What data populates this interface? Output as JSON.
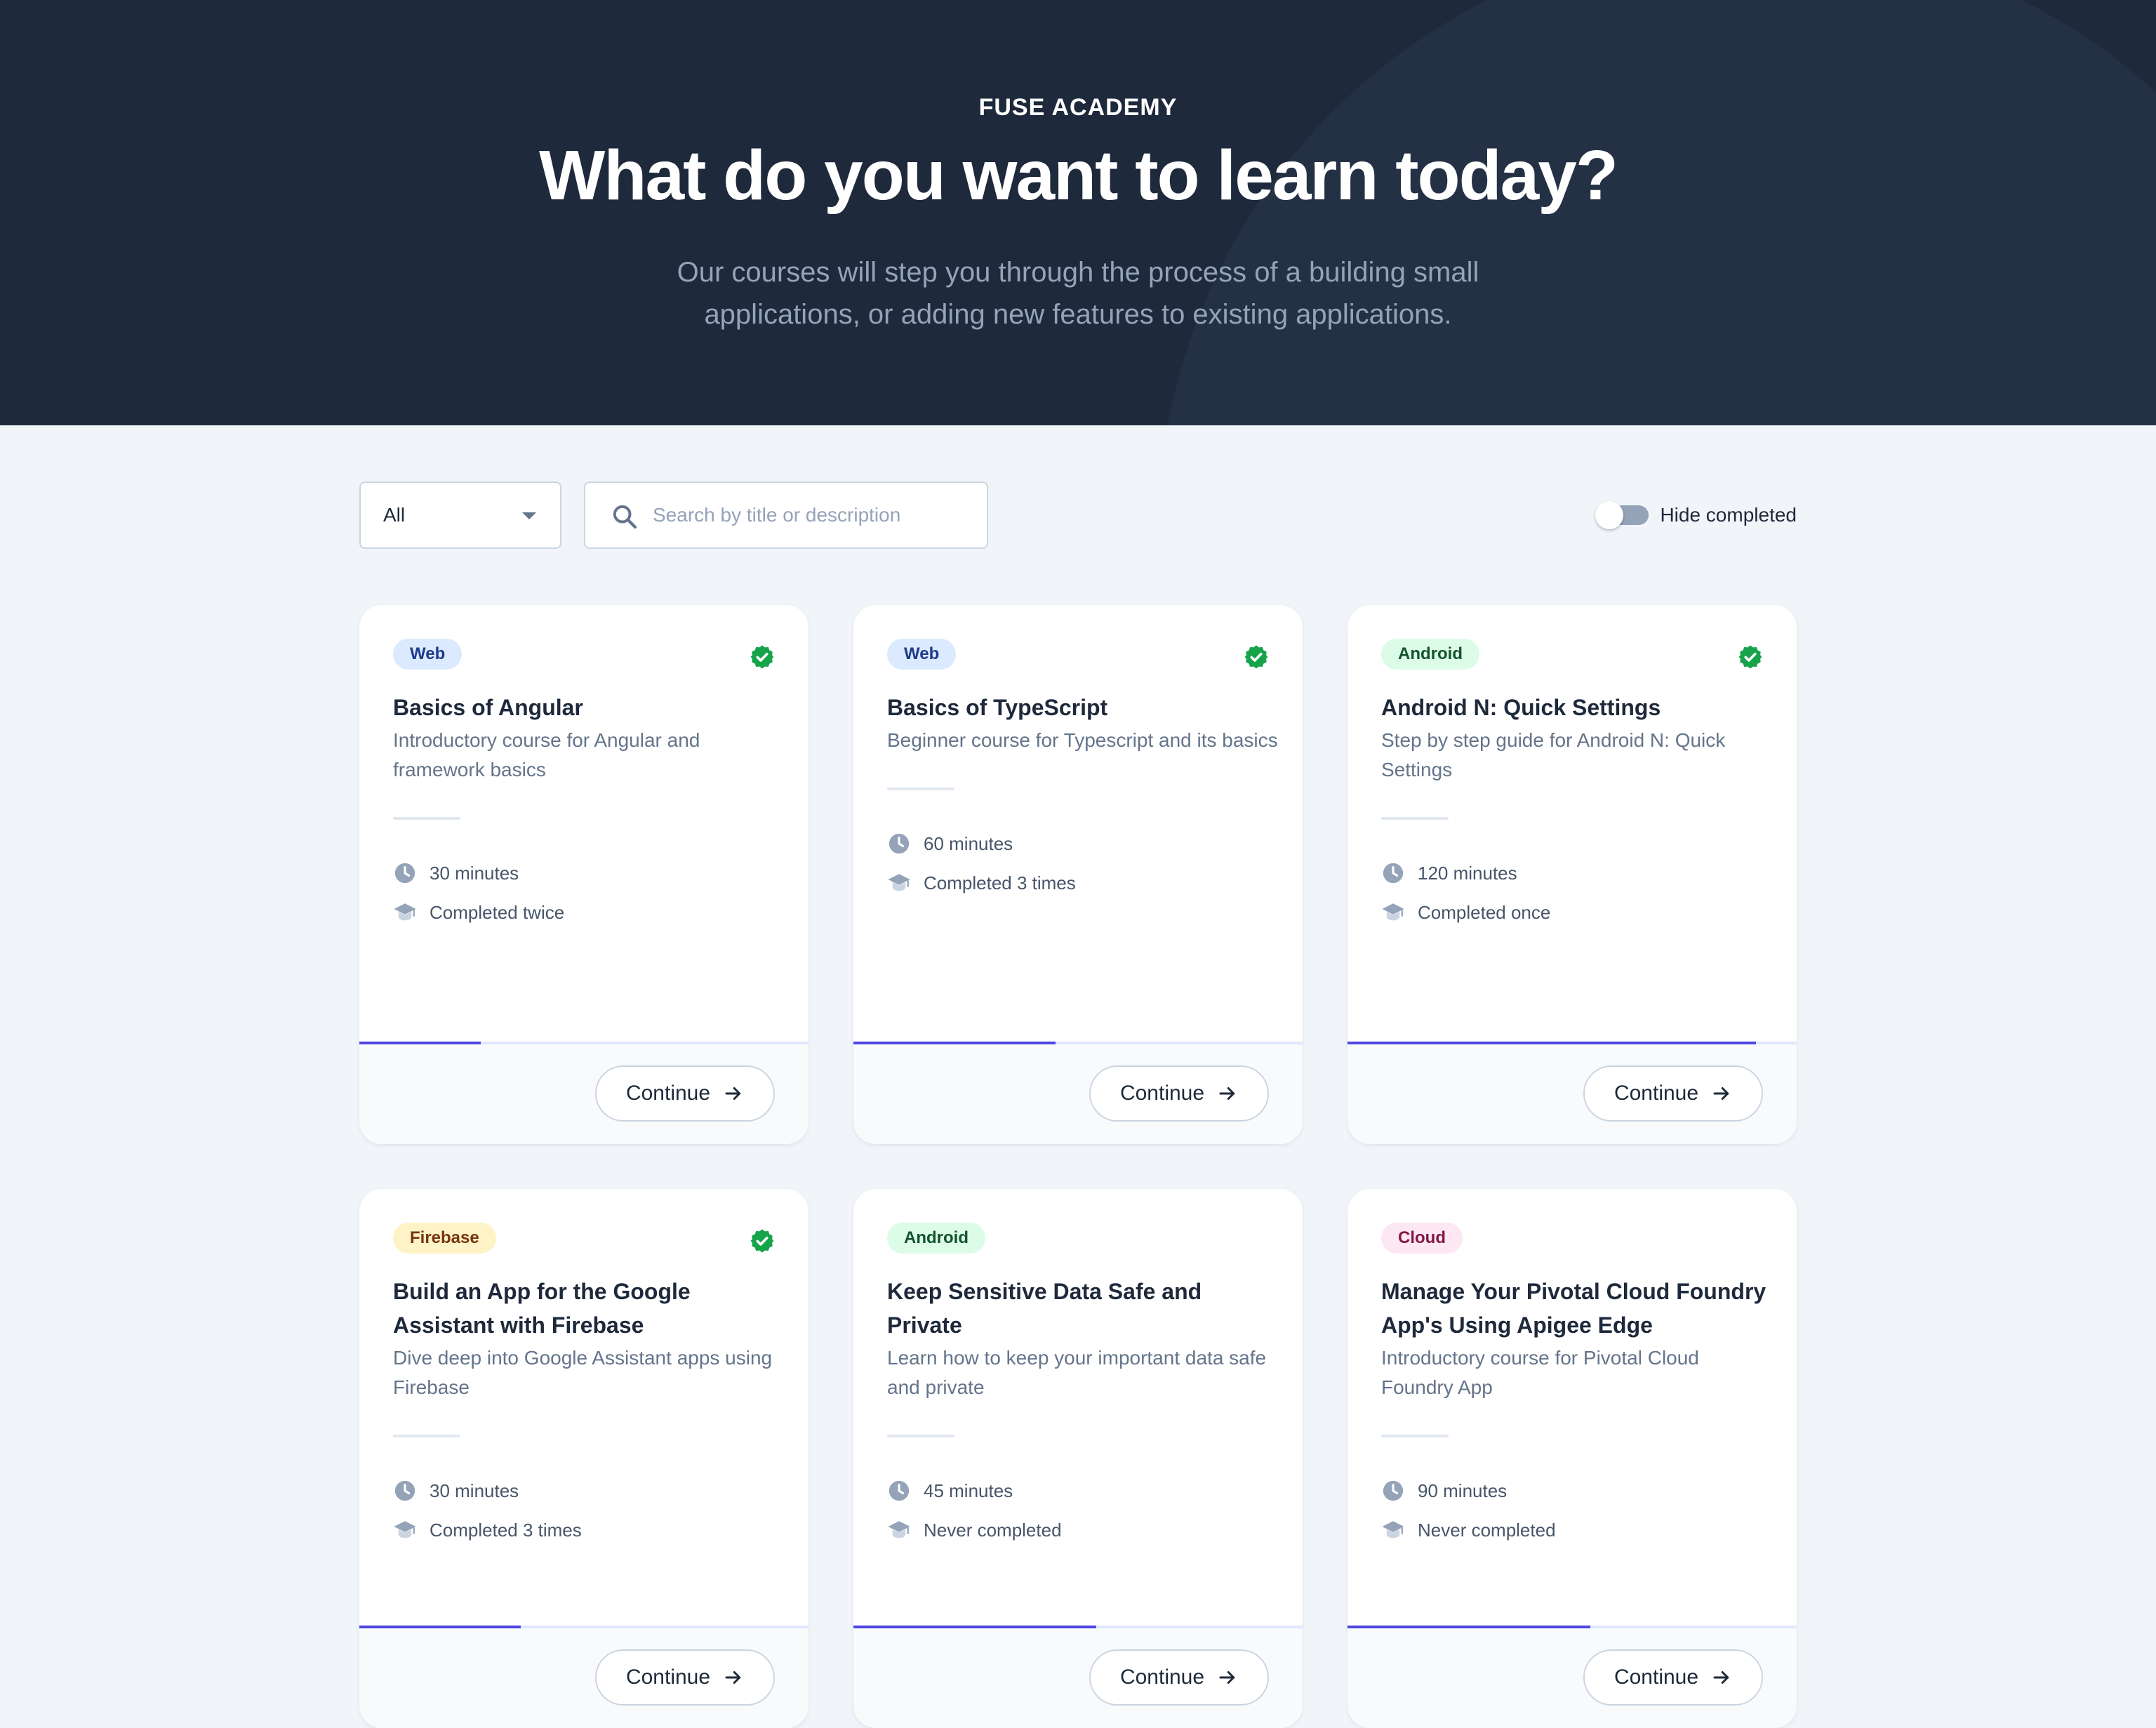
{
  "hero": {
    "eyebrow": "FUSE ACADEMY",
    "title": "What do you want to learn today?",
    "subtitle": "Our courses will step you through the process of a building small applications, or adding new features to existing applications."
  },
  "toolbar": {
    "category_selected": "All",
    "search_placeholder": "Search by title or description",
    "hide_completed_label": "Hide completed",
    "hide_completed_on": false
  },
  "icons": {
    "search": "search-icon",
    "caret": "chevron-down-icon",
    "check": "check-circle-icon",
    "clock": "clock-icon",
    "completed": "graduation-cap-icon",
    "arrow": "arrow-right-icon"
  },
  "colors": {
    "hero_bg": "#1e293b",
    "accent": "#4f46e5",
    "check_green": "#16a34a"
  },
  "courses": [
    {
      "category": "Web",
      "category_class": "web",
      "title": "Basics of Angular",
      "description": "Introductory course for Angular and framework basics",
      "duration": "30 minutes",
      "completed_text": "Completed twice",
      "is_completed": true,
      "progress": 0.27,
      "action": "Continue"
    },
    {
      "category": "Web",
      "category_class": "web",
      "title": "Basics of TypeScript",
      "description": "Beginner course for Typescript and its basics",
      "duration": "60 minutes",
      "completed_text": "Completed 3 times",
      "is_completed": true,
      "progress": 0.45,
      "action": "Continue"
    },
    {
      "category": "Android",
      "category_class": "android",
      "title": "Android N: Quick Settings",
      "description": "Step by step guide for Android N: Quick Settings",
      "duration": "120 minutes",
      "completed_text": "Completed once",
      "is_completed": true,
      "progress": 0.91,
      "action": "Continue"
    },
    {
      "category": "Firebase",
      "category_class": "firebase",
      "title": "Build an App for the Google Assistant with Firebase",
      "description": "Dive deep into Google Assistant apps using Firebase",
      "duration": "30 minutes",
      "completed_text": "Completed 3 times",
      "is_completed": true,
      "progress": 0.36,
      "action": "Continue"
    },
    {
      "category": "Android",
      "category_class": "android",
      "title": "Keep Sensitive Data Safe and Private",
      "description": "Learn how to keep your important data safe and private",
      "duration": "45 minutes",
      "completed_text": "Never completed",
      "is_completed": false,
      "progress": 0.54,
      "action": "Continue"
    },
    {
      "category": "Cloud",
      "category_class": "cloud",
      "title": "Manage Your Pivotal Cloud Foundry App's Using Apigee Edge",
      "description": "Introductory course for Pivotal Cloud Foundry App",
      "duration": "90 minutes",
      "completed_text": "Never completed",
      "is_completed": false,
      "progress": 0.54,
      "action": "Continue"
    }
  ]
}
